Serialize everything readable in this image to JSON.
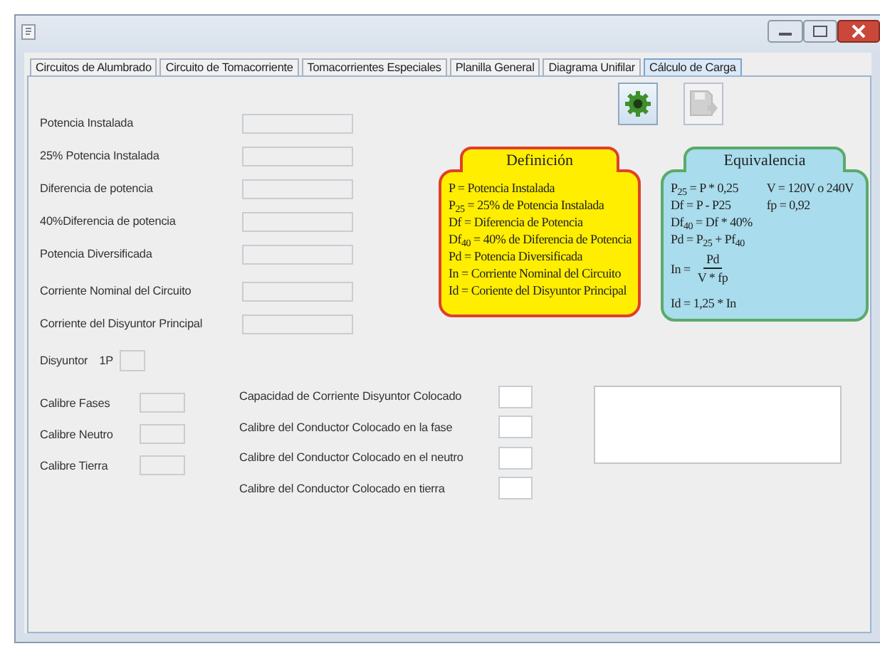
{
  "tabs": [
    {
      "label": "Circuitos de Alumbrado",
      "selected": false
    },
    {
      "label": "Circuito de Tomacorriente",
      "selected": false
    },
    {
      "label": "Tomacorrientes Especiales",
      "selected": false
    },
    {
      "label": "Planilla General",
      "selected": false
    },
    {
      "label": "Diagrama Unifilar",
      "selected": false
    },
    {
      "label": "Cálculo de Carga",
      "selected": true
    }
  ],
  "toolbar": [
    {
      "kind": "gear",
      "disabled": false
    },
    {
      "kind": "save",
      "disabled": true
    }
  ],
  "fields": [
    {
      "label": "Potencia Instalada",
      "disabled": true
    },
    {
      "label": "25% Potencia Instalada",
      "disabled": true
    },
    {
      "label": "Diferencia de potencia",
      "disabled": true
    },
    {
      "label": "40%Diferencia de potencia",
      "disabled": true
    },
    {
      "label": "Potencia Diversificada",
      "disabled": true
    },
    {
      "label": "Corriente Nominal del Circuito",
      "disabled": true
    },
    {
      "label": "Corriente del Disyuntor Principal",
      "disabled": true
    }
  ],
  "disyuntor": {
    "label": "Disyuntor",
    "value_label": "1P"
  },
  "calibres": [
    {
      "label": "Calibre Fases",
      "disabled": true
    },
    {
      "label": "Calibre Neutro",
      "disabled": true
    },
    {
      "label": "Calibre Tierra",
      "disabled": true
    }
  ],
  "colocados": [
    {
      "label": "Capacidad de Corriente Disyuntor Colocado",
      "disabled": false
    },
    {
      "label": "Calibre del Conductor Colocado en la fase",
      "disabled": false
    },
    {
      "label": "Calibre del Conductor Colocado en el neutro",
      "disabled": false
    },
    {
      "label": "Calibre del Conductor Colocado en tierra",
      "disabled": false
    }
  ],
  "definicion": {
    "title": "Definición",
    "lines": [
      "P = Potencia Instalada",
      "P$_{25}$ = 25% de Potencia Instalada",
      "Df = Diferencia de Potencia",
      "Df$_{40}$ = 40% de Diferencia de Potencia",
      "Pd = Potencia Diversificada",
      "In = Corriente Nominal del Circuito",
      "Id = Coriente del Disyuntor Principal"
    ]
  },
  "equivalencia": {
    "title": "Equivalencia",
    "column_1": [
      {
        "kind": "text",
        "text": "P$_{25}$ = P * 0,25"
      },
      {
        "kind": "text",
        "text": "Df = P - P25"
      },
      {
        "kind": "text",
        "text": "Df$_{40}$ = Df * 40%"
      },
      {
        "kind": "text",
        "text": "Pd = P$_{25}$ + Pf$_{40}$"
      },
      {
        "kind": "fraction",
        "lhs": "In =",
        "numerator": "Pd",
        "denominator": "V * fp"
      },
      {
        "kind": "text",
        "text": "Id = 1,25 * In"
      }
    ],
    "column_2": [
      {
        "kind": "text",
        "text": "V = 120V o 240V"
      },
      {
        "kind": "text",
        "text": "fp = 0,92"
      }
    ]
  }
}
